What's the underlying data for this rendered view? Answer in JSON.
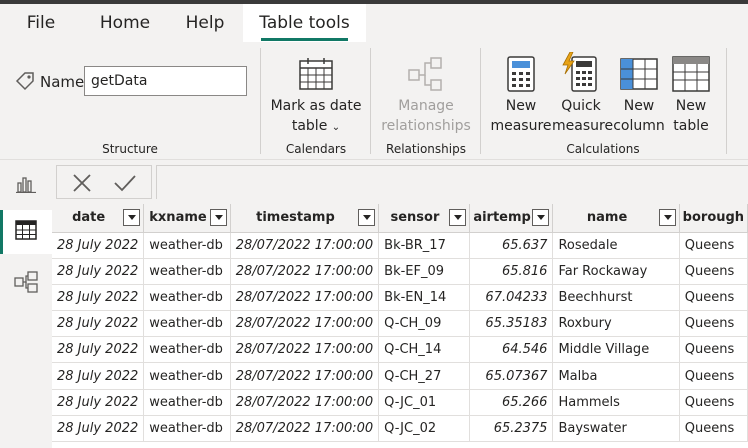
{
  "menu": {
    "file": "File",
    "home": "Home",
    "help": "Help",
    "table_tools": "Table tools"
  },
  "ribbon": {
    "name_label": "Name",
    "name_value": "getData",
    "structure_label": "Structure",
    "mark_as_date_line1": "Mark as date",
    "mark_as_date_line2": "table",
    "calendars_label": "Calendars",
    "manage_rel_line1": "Manage",
    "manage_rel_line2": "relationships",
    "relationships_label": "Relationships",
    "new_measure_line1": "New",
    "new_measure_line2": "measure",
    "quick_measure_line1": "Quick",
    "quick_measure_line2": "measure",
    "new_column_line1": "New",
    "new_column_line2": "column",
    "new_table_line1": "New",
    "new_table_line2": "table",
    "calculations_label": "Calculations"
  },
  "icons": {
    "report_view": "bar-chart-icon",
    "data_view": "table-grid-icon",
    "model_view": "model-icon",
    "cancel": "close-icon",
    "commit": "checkmark-icon"
  },
  "colors": {
    "accent": "#117865",
    "quick_measure_bolt": "#e8a317",
    "new_column_blue": "#4a90d9"
  },
  "table": {
    "columns": [
      "date",
      "kxname",
      "timestamp",
      "sensor",
      "airtemp",
      "name",
      "borough"
    ],
    "rows": [
      [
        "28 July 2022",
        "weather-db",
        "28/07/2022 17:00:00",
        "Bk-BR_17",
        "65.637",
        "Rosedale",
        "Queens"
      ],
      [
        "28 July 2022",
        "weather-db",
        "28/07/2022 17:00:00",
        "Bk-EF_09",
        "65.816",
        "Far Rockaway",
        "Queens"
      ],
      [
        "28 July 2022",
        "weather-db",
        "28/07/2022 17:00:00",
        "Bk-EN_14",
        "67.04233",
        "Beechhurst",
        "Queens"
      ],
      [
        "28 July 2022",
        "weather-db",
        "28/07/2022 17:00:00",
        "Q-CH_09",
        "65.35183",
        "Roxbury",
        "Queens"
      ],
      [
        "28 July 2022",
        "weather-db",
        "28/07/2022 17:00:00",
        "Q-CH_14",
        "64.546",
        "Middle Village",
        "Queens"
      ],
      [
        "28 July 2022",
        "weather-db",
        "28/07/2022 17:00:00",
        "Q-CH_27",
        "65.07367",
        "Malba",
        "Queens"
      ],
      [
        "28 July 2022",
        "weather-db",
        "28/07/2022 17:00:00",
        "Q-JC_01",
        "65.266",
        "Hammels",
        "Queens"
      ],
      [
        "28 July 2022",
        "weather-db",
        "28/07/2022 17:00:00",
        "Q-JC_02",
        "65.2375",
        "Bayswater",
        "Queens"
      ]
    ]
  }
}
